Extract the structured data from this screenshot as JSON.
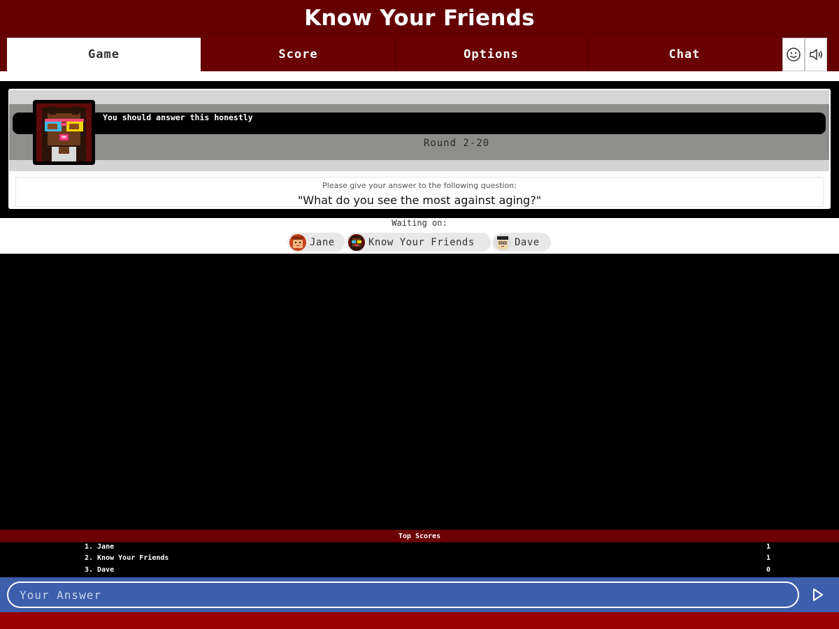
{
  "app": {
    "title": "Know Your Friends"
  },
  "tabs": [
    {
      "label": "Game",
      "active": true
    },
    {
      "label": "Score",
      "active": false
    },
    {
      "label": "Options",
      "active": false
    },
    {
      "label": "Chat",
      "active": false
    }
  ],
  "toolbar": {
    "icons": [
      "smiley-icon",
      "speaker-icon"
    ]
  },
  "question_panel": {
    "speech": "You should answer this honestly",
    "round": "Round 2-20",
    "prompt": "Please give your answer to the following question:",
    "question": "\"What do you see the most against aging?\""
  },
  "waiting": {
    "label": "Waiting on:",
    "players": [
      "Jane",
      "Know Your Friends",
      "Dave"
    ]
  },
  "top_scores": {
    "title": "Top Scores",
    "rows": [
      {
        "name": "1. Jane",
        "score": "1"
      },
      {
        "name": "2. Know Your Friends",
        "score": "1"
      },
      {
        "name": "3. Dave",
        "score": "0"
      }
    ]
  },
  "answer": {
    "placeholder": "Your Answer",
    "value": ""
  },
  "colors": {
    "header": "#650000",
    "tab_inactive": "#6a0000",
    "answer_bar": "#3d5eab",
    "footer": "#9a0000"
  }
}
